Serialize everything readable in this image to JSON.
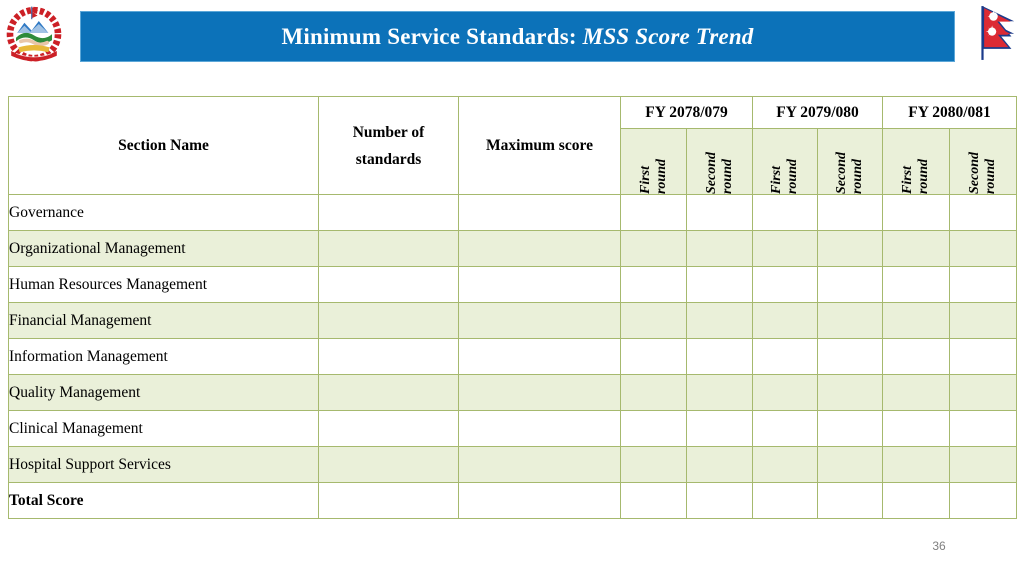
{
  "slide": {
    "page_number": "36",
    "title_main": "Minimum Service Standards:",
    "title_emphasis": " MSS Score Trend",
    "title_bar_color": "#0c72b9",
    "title_text_color": "#ffffff",
    "table_border_color": "#a6b96e",
    "table_alt_row_color": "#eaf0d9",
    "emblem_alt": "emblem-of-nepal-icon",
    "flag_alt": "flag-of-nepal-icon"
  },
  "table": {
    "headers": {
      "section_name": "Section Name",
      "number_of_standards": "Number of standards",
      "maximum_score": "Maximum score",
      "fiscal_years": [
        "FY 2078/079",
        "FY 2079/080",
        "FY 2080/081"
      ],
      "round_labels": [
        {
          "word1": "First",
          "word2": "round"
        },
        {
          "word1": "Second",
          "word2": "round"
        },
        {
          "word1": "First",
          "word2": "round"
        },
        {
          "word1": "Second",
          "word2": "round"
        },
        {
          "word1": "First",
          "word2": "round"
        },
        {
          "word1": "Second",
          "word2": "round"
        }
      ]
    },
    "rows": [
      {
        "section": "Governance",
        "bold": false,
        "standards": "",
        "max_score": "",
        "scores": [
          "",
          "",
          "",
          "",
          "",
          ""
        ]
      },
      {
        "section": "Organizational Management",
        "bold": false,
        "standards": "",
        "max_score": "",
        "scores": [
          "",
          "",
          "",
          "",
          "",
          ""
        ]
      },
      {
        "section": "Human Resources Management",
        "bold": false,
        "standards": "",
        "max_score": "",
        "scores": [
          "",
          "",
          "",
          "",
          "",
          ""
        ]
      },
      {
        "section": "Financial Management",
        "bold": false,
        "standards": "",
        "max_score": "",
        "scores": [
          "",
          "",
          "",
          "",
          "",
          ""
        ]
      },
      {
        "section": "Information Management",
        "bold": false,
        "standards": "",
        "max_score": "",
        "scores": [
          "",
          "",
          "",
          "",
          "",
          ""
        ]
      },
      {
        "section": "Quality Management",
        "bold": false,
        "standards": "",
        "max_score": "",
        "scores": [
          "",
          "",
          "",
          "",
          "",
          ""
        ]
      },
      {
        "section": "Clinical Management",
        "bold": false,
        "standards": "",
        "max_score": "",
        "scores": [
          "",
          "",
          "",
          "",
          "",
          ""
        ]
      },
      {
        "section": "Hospital Support Services",
        "bold": false,
        "standards": "",
        "max_score": "",
        "scores": [
          "",
          "",
          "",
          "",
          "",
          ""
        ]
      },
      {
        "section": "Total Score",
        "bold": true,
        "standards": "",
        "max_score": "",
        "scores": [
          "",
          "",
          "",
          "",
          "",
          ""
        ]
      }
    ]
  }
}
